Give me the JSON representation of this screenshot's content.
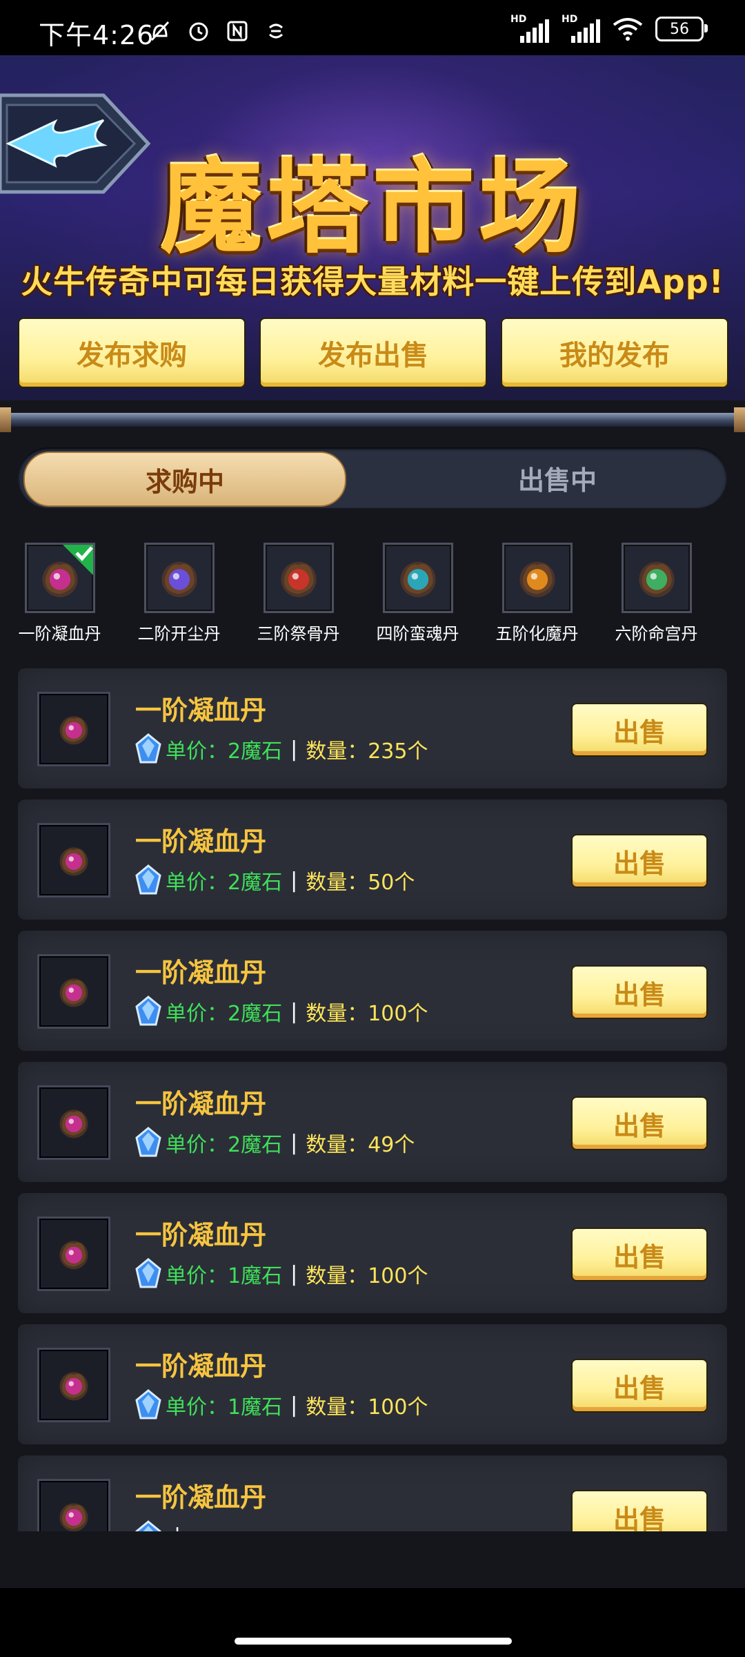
{
  "status_bar": {
    "time": "下午4:26",
    "icons": [
      "do-not-disturb-icon",
      "alarm-icon",
      "nfc-icon",
      "notification-icon"
    ],
    "sim1": "HD",
    "sim2": "HD",
    "battery": "56"
  },
  "header": {
    "title": "魔塔市场",
    "subtitle": "火牛传奇中可每日获得大量材料一键上传到App!",
    "buttons": [
      "发布求购",
      "发布出售",
      "我的发布"
    ]
  },
  "tabs": {
    "active": "求购中",
    "inactive": "出售中"
  },
  "categories": [
    {
      "name": "一阶凝血丹",
      "color": "#c52f8e",
      "selected": true
    },
    {
      "name": "二阶开尘丹",
      "color": "#6b4fd8",
      "selected": false
    },
    {
      "name": "三阶祭骨丹",
      "color": "#c7342a",
      "selected": false
    },
    {
      "name": "四阶蛮魂丹",
      "color": "#2aa6b8",
      "selected": false
    },
    {
      "name": "五阶化魔丹",
      "color": "#e08a1e",
      "selected": false
    },
    {
      "name": "六阶命宫丹",
      "color": "#3fae62",
      "selected": false
    }
  ],
  "listings": [
    {
      "name": "一阶凝血丹",
      "price": "单价：2魔石",
      "qty": "数量：235个",
      "action": "出售"
    },
    {
      "name": "一阶凝血丹",
      "price": "单价：2魔石",
      "qty": "数量：50个",
      "action": "出售"
    },
    {
      "name": "一阶凝血丹",
      "price": "单价：2魔石",
      "qty": "数量：100个",
      "action": "出售"
    },
    {
      "name": "一阶凝血丹",
      "price": "单价：2魔石",
      "qty": "数量：49个",
      "action": "出售"
    },
    {
      "name": "一阶凝血丹",
      "price": "单价：1魔石",
      "qty": "数量：100个",
      "action": "出售"
    },
    {
      "name": "一阶凝血丹",
      "price": "单价：1魔石",
      "qty": "数量：100个",
      "action": "出售"
    },
    {
      "name": "一阶凝血丹",
      "price": "",
      "qty": "",
      "action": "出售"
    }
  ],
  "separator": "|"
}
